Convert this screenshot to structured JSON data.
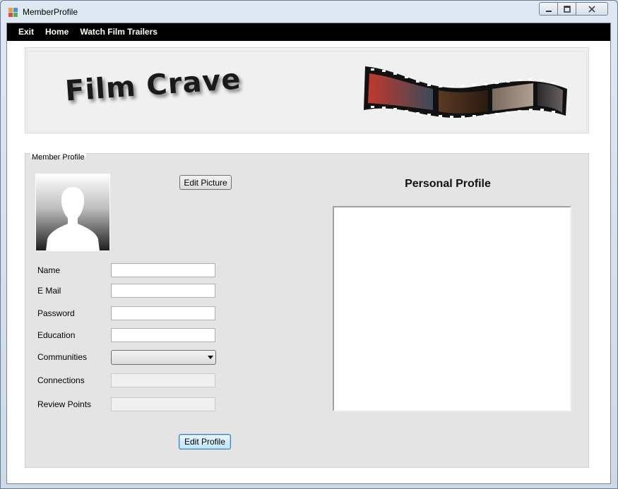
{
  "window": {
    "title": "MemberProfile",
    "controls": {
      "minimize_icon": "minimize-icon",
      "maximize_icon": "restore-icon",
      "close_icon": "close-icon"
    }
  },
  "menu": {
    "items": [
      {
        "label": "Exit"
      },
      {
        "label": "Home"
      },
      {
        "label": "Watch Film Trailers"
      }
    ]
  },
  "banner": {
    "logo_text": "Film Crave",
    "filmstrip_image": "film-strip-image"
  },
  "member_profile": {
    "group_title": "Member Profile",
    "avatar_icon": "silhouette-avatar-icon",
    "edit_picture_label": "Edit Picture",
    "fields": {
      "name": {
        "label": "Name",
        "value": ""
      },
      "email": {
        "label": "E Mail",
        "value": ""
      },
      "password": {
        "label": "Password",
        "value": ""
      },
      "education": {
        "label": "Education",
        "value": ""
      },
      "communities": {
        "label": "Communities",
        "value": ""
      },
      "connections": {
        "label": "Connections",
        "value": ""
      },
      "review_points": {
        "label": "Review Points",
        "value": ""
      }
    },
    "edit_profile_label": "Edit Profile"
  },
  "personal_profile": {
    "title": "Personal Profile",
    "text": ""
  },
  "colors": {
    "menubar": "#000000",
    "panel": "#e4e4e4",
    "banner": "#f0f0f0"
  }
}
